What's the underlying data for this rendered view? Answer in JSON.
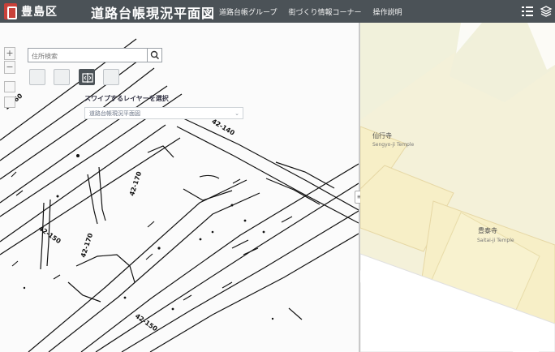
{
  "header": {
    "city": "豊島区",
    "title": "道路台帳現況平面図",
    "links": [
      "道路台帳グループ",
      "街づくり情報コーナー",
      "操作説明"
    ]
  },
  "search": {
    "placeholder": "住所検索"
  },
  "swipe": {
    "label": "スワイプするレイヤーを選択",
    "selected": "道路台帳現況平面図"
  },
  "map_labels": {
    "label_140": "42-140",
    "label_170a": "42-170",
    "label_150a": "42-150",
    "label_170b": "42-170",
    "label_150b": "42-150",
    "label_160": "2-160"
  },
  "places": {
    "temple1_jp": "仙行寺",
    "temple1_en": "Sengyo-ji Temple",
    "temple2_jp": "豊泰寺",
    "temple2_en": "Saitai-ji Temple"
  },
  "icons": {
    "search": "search-icon",
    "menu": "menu-icon",
    "layers": "layers-icon",
    "swipe": "swipe-icon"
  },
  "colors": {
    "header": "#4b5257",
    "map_right": "#f3f0d7",
    "block": "#f7efc7"
  }
}
